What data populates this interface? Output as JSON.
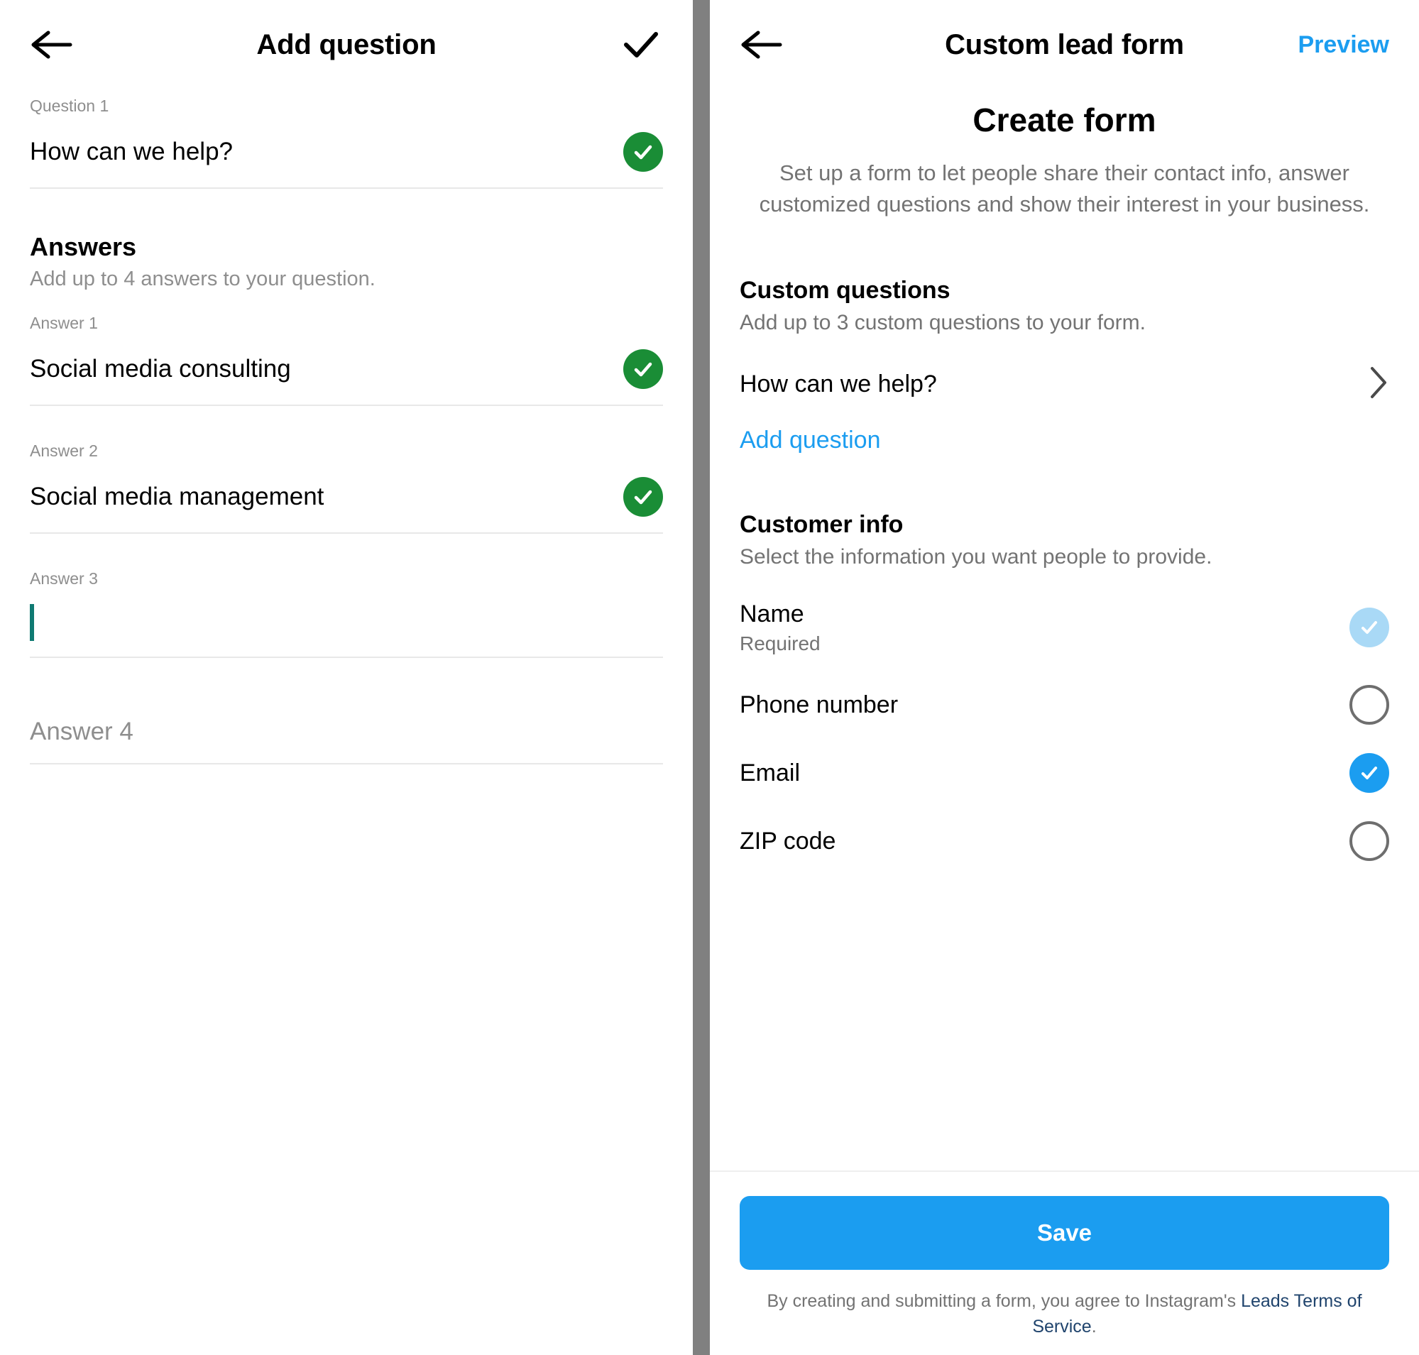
{
  "left_panel": {
    "topbar": {
      "back_icon": "back-arrow-icon",
      "title": "Add question",
      "confirm_icon": "checkmark-icon"
    },
    "question": {
      "label": "Question 1",
      "value": "How can we help?",
      "status_icon": "green-check-icon"
    },
    "answers_section": {
      "title": "Answers",
      "subtitle": "Add up to 4 answers to your question."
    },
    "answers": [
      {
        "label": "Answer 1",
        "value": "Social media consulting",
        "checked": true,
        "placeholder": false
      },
      {
        "label": "Answer 2",
        "value": "Social media management",
        "checked": true,
        "placeholder": false
      },
      {
        "label": "Answer 3",
        "value": "",
        "checked": false,
        "placeholder": false
      },
      {
        "label": "",
        "value": "Answer 4",
        "checked": false,
        "placeholder": true
      }
    ]
  },
  "right_panel": {
    "topbar": {
      "back_icon": "back-arrow-icon",
      "title": "Custom lead form",
      "action_label": "Preview"
    },
    "hero": {
      "title": "Create form",
      "description": "Set up a form to let people share their contact info, answer customized questions and show their interest in your business."
    },
    "custom_questions": {
      "title": "Custom questions",
      "subtitle": "Add up to 3 custom questions to your form.",
      "items": [
        {
          "label": "How can we help?",
          "chevron_icon": "chevron-right-icon"
        }
      ],
      "add_link": "Add question"
    },
    "customer_info": {
      "title": "Customer info",
      "subtitle": "Select the information you want people to provide.",
      "fields": [
        {
          "label": "Name",
          "sub": "Required",
          "state": "disabled-checked"
        },
        {
          "label": "Phone number",
          "sub": "",
          "state": "off"
        },
        {
          "label": "Email",
          "sub": "",
          "state": "on"
        },
        {
          "label": "ZIP code",
          "sub": "",
          "state": "off"
        }
      ]
    },
    "footer": {
      "save_label": "Save",
      "legal_prefix": "By creating and submitting a form, you agree to Instagram's ",
      "legal_link": "Leads Terms of Service",
      "legal_suffix": "."
    }
  },
  "colors": {
    "accent_blue": "#1b9df0",
    "green": "#1a8d36",
    "disabled_blue": "#a9d9f6",
    "link_navy": "#20446d",
    "caret_teal": "#0f7a72",
    "divider_gray": "#808080"
  }
}
